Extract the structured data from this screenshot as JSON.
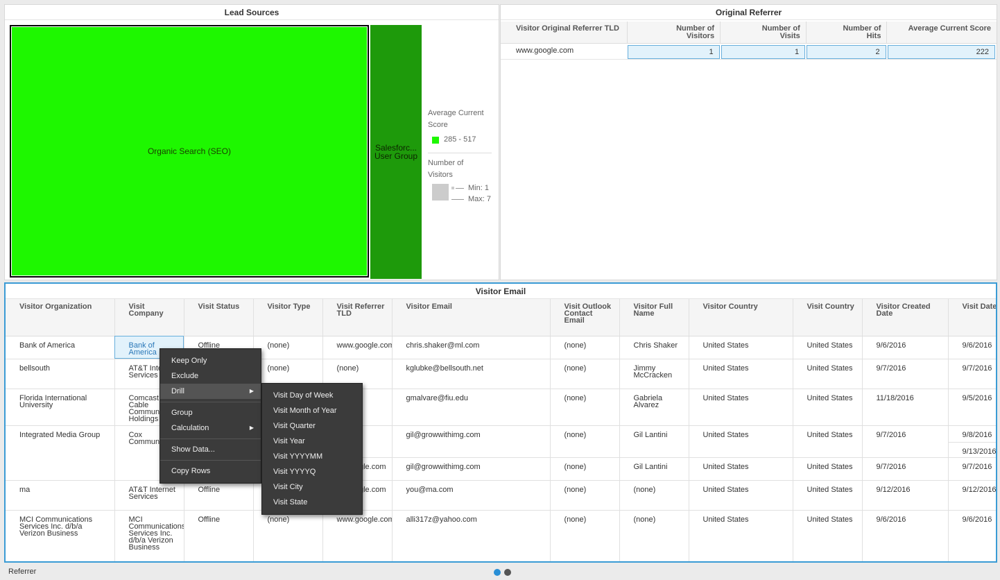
{
  "lead_sources": {
    "title": "Lead Sources",
    "tiles": [
      {
        "label": "Organic Search (SEO)",
        "color": "#1ef700"
      },
      {
        "label_line1": "Salesforc...",
        "label_line2": "User Group",
        "color": "#1e9a0b"
      }
    ],
    "legend": {
      "color_title": "Average Current Score",
      "color_range": "285 - 517",
      "size_title": "Number of Visitors",
      "min": "Min: 1",
      "max": "Max: 7"
    }
  },
  "original_referrer": {
    "title": "Original Referrer",
    "columns": [
      "Visitor Original Referrer TLD",
      "Number of Visitors",
      "Number of Visits",
      "Number of Hits",
      "Average Current Score"
    ],
    "row": {
      "tld": "www.google.com",
      "visitors": "1",
      "visits": "1",
      "hits": "2",
      "score": "222"
    }
  },
  "visitor_email": {
    "title": "Visitor Email",
    "columns": [
      "Visitor Organization",
      "Visit Company",
      "Visit Status",
      "Visitor Type",
      "Visit Referrer TLD",
      "Visitor Email",
      "Visit Outlook Contact Email",
      "Visitor Full Name",
      "Visitor Country",
      "Visit Country",
      "Visitor Created Date",
      "Visit Date"
    ],
    "rows": [
      {
        "org": "Bank of America",
        "company": "Bank of America",
        "status": "Offline",
        "type": "(none)",
        "tld": "www.google.com",
        "email": "chris.shaker@ml.com",
        "outlook": "(none)",
        "name": "Chris Shaker",
        "vcountry": "United States",
        "country": "United States",
        "created": "9/6/2016",
        "date": "9/6/2016"
      },
      {
        "org": "bellsouth",
        "company": "AT&T Internet Services",
        "status": "",
        "type": "(none)",
        "tld": "(none)",
        "email": "kglubke@bellsouth.net",
        "outlook": "(none)",
        "name": "Jimmy McCracken",
        "vcountry": "United States",
        "country": "United States",
        "created": "9/7/2016",
        "date": "9/7/2016"
      },
      {
        "org": "Florida International University",
        "company": "Comcast Cable Communications Holdings",
        "status": "",
        "type": "",
        "tld": "",
        "email": "gmalvare@fiu.edu",
        "outlook": "(none)",
        "name": "Gabriela Alvarez",
        "vcountry": "United States",
        "country": "United States",
        "created": "11/18/2016",
        "date": "9/5/2016"
      },
      {
        "org": "Integrated Media Group",
        "company": "Cox Communications",
        "status": "",
        "type": "",
        "tld": "",
        "email": "gil@growwithimg.com",
        "outlook": "(none)",
        "name": "Gil Lantini",
        "vcountry": "United States",
        "country": "United States",
        "created": "9/7/2016",
        "date": "9/8/2016",
        "date2": "9/13/2016"
      },
      {
        "org": "",
        "company": "",
        "status": "",
        "type": "",
        "tld": "www.google.com",
        "email": "gil@growwithimg.com",
        "outlook": "(none)",
        "name": "Gil Lantini",
        "vcountry": "United States",
        "country": "United States",
        "created": "9/7/2016",
        "date": "9/7/2016"
      },
      {
        "org": "ma",
        "company": "AT&T Internet Services",
        "status": "Offline",
        "type": "",
        "tld": "www.google.com",
        "email": "you@ma.com",
        "outlook": "(none)",
        "name": "(none)",
        "vcountry": "United States",
        "country": "United States",
        "created": "9/12/2016",
        "date": "9/12/2016"
      },
      {
        "org": "MCI Communications Services Inc. d/b/a Verizon Business",
        "company": "MCI Communications Services Inc. d/b/a Verizon Business",
        "status": "Offline",
        "type": "(none)",
        "tld": "www.google.com",
        "email": "alli317z@yahoo.com",
        "outlook": "(none)",
        "name": "(none)",
        "vcountry": "United States",
        "country": "United States",
        "created": "9/6/2016",
        "date": "9/6/2016"
      }
    ]
  },
  "context_menu": {
    "items": [
      "Keep Only",
      "Exclude",
      "Drill",
      "Group",
      "Calculation",
      "Show Data...",
      "Copy Rows"
    ],
    "submenu": [
      "Visit Day of Week",
      "Visit Month of Year",
      "Visit Quarter",
      "Visit Year",
      "Visit YYYYMM",
      "Visit YYYYQ",
      "Visit City",
      "Visit State"
    ]
  },
  "footer": {
    "tab": "Referrer",
    "active_dot_color": "#2a8fd6"
  }
}
